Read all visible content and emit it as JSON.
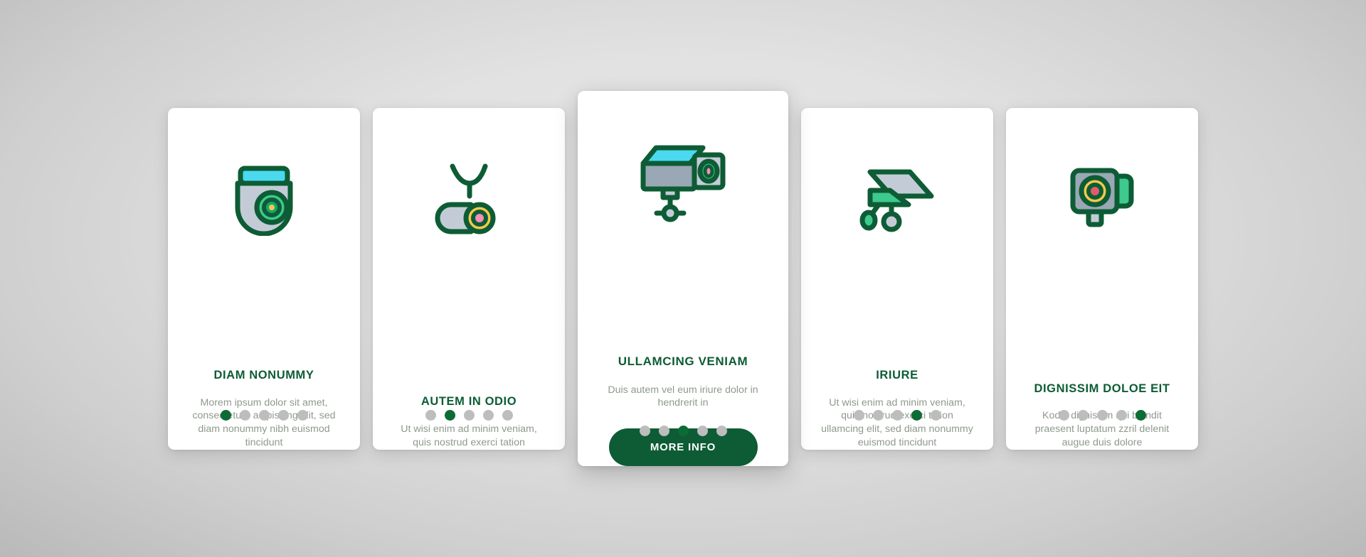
{
  "theme": {
    "background_gray": "#dcdcdc",
    "card_background": "#ffffff",
    "title_green": "#0d5c35",
    "body_gray": "#8e9a8c",
    "dot_active": "#0d6b36",
    "dot_inactive": "#bdbdbd",
    "icon_cyan": "#4ad9ef",
    "icon_green": "#3ec98f",
    "icon_gray": "#c3ccd6",
    "icon_outline": "#0d5c35",
    "icon_yellow": "#f2c94c",
    "icon_pink": "#f48fb6",
    "button_green": "#0d5c35"
  },
  "cards": [
    {
      "icon": "dome-camera-icon",
      "title": "DIAM NONUMMY",
      "body": "Morem ipsum dolor sit amet, consectetuer adipiscing elit, sed diam nonummy nibh euismod tincidunt",
      "dots": 5,
      "active_dot": 0,
      "has_button": false,
      "featured": false
    },
    {
      "icon": "ceiling-camera-icon",
      "title": "AUTEM IN ODIO",
      "body": "Ut wisi enim ad minim veniam, quis nostrud exerci tation",
      "dots": 5,
      "active_dot": 1,
      "has_button": false,
      "featured": false
    },
    {
      "icon": "cctv-camera-icon",
      "title": "ULLAMCING VENIAM",
      "body": "Duis autem vel eum iriure dolor in hendrerit in",
      "button_label": "MORE INFO",
      "dots": 5,
      "active_dot": 2,
      "has_button": true,
      "featured": true
    },
    {
      "icon": "wall-camera-icon",
      "title": "IRIURE",
      "body": "Ut wisi enim ad minim veniam, quis nostrud exerci tation ullamcing elit, sed diam nonummy euismod tincidunt",
      "dots": 5,
      "active_dot": 3,
      "has_button": false,
      "featured": false
    },
    {
      "icon": "box-camera-icon",
      "title": "DIGNISSIM DOLOE EIT",
      "body": "Kodio dignissim qui blandit praesent luptatum zzril delenit augue duis dolore",
      "dots": 5,
      "active_dot": 4,
      "has_button": false,
      "featured": false
    }
  ]
}
